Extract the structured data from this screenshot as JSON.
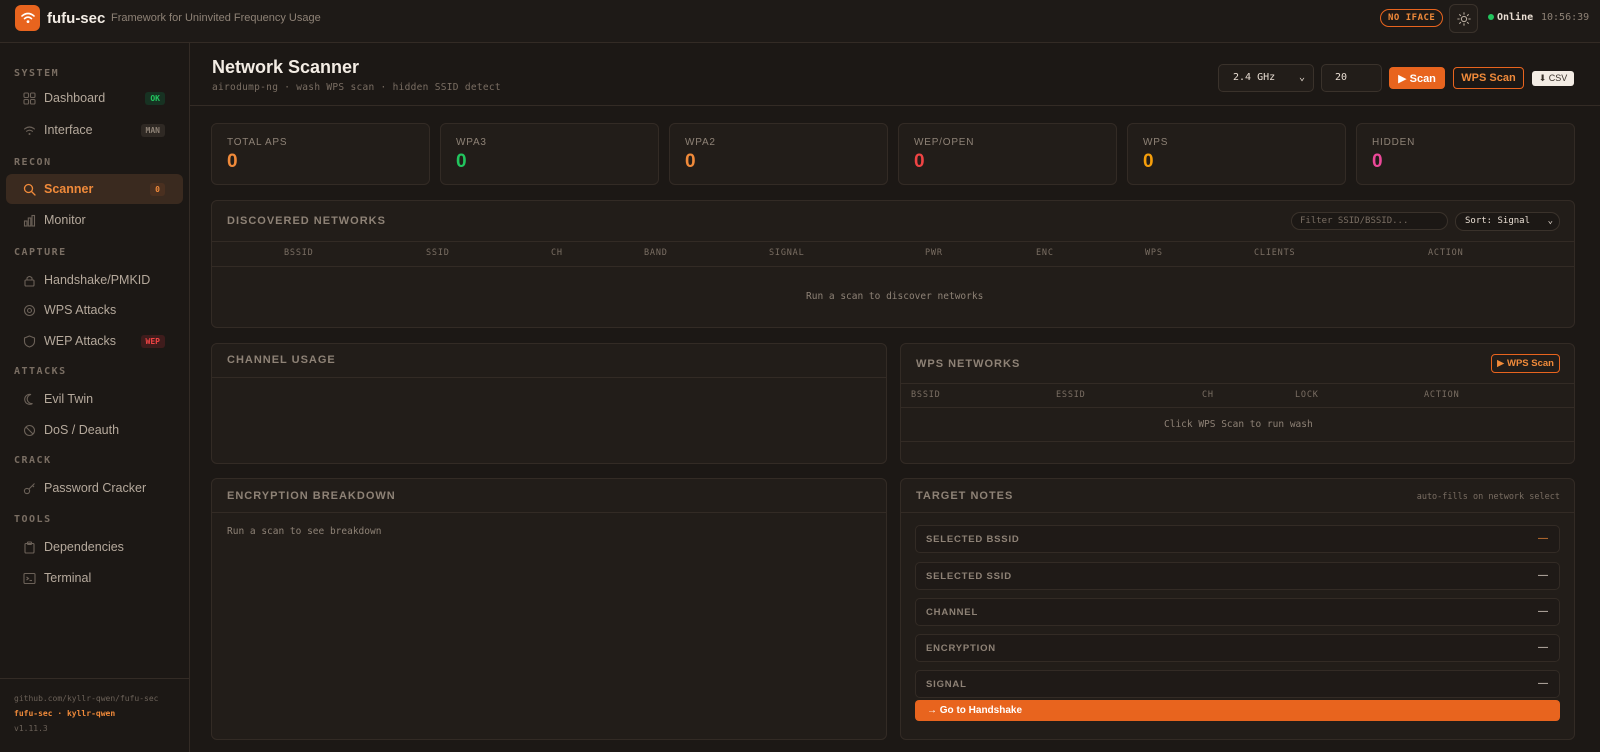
{
  "app": {
    "name": "fufu-sec",
    "tagline": "Framework for Uninvited Frequency Usage"
  },
  "topbar": {
    "iface_badge": "NO IFACE",
    "status": "Online",
    "clock": "10:56:39"
  },
  "sidebar": {
    "sections": {
      "system": "SYSTEM",
      "recon": "RECON",
      "capture": "CAPTURE",
      "attacks": "ATTACKS",
      "crack": "CRACK",
      "tools": "TOOLS"
    },
    "items": {
      "dashboard": {
        "label": "Dashboard",
        "badge": "OK"
      },
      "interface": {
        "label": "Interface",
        "badge": "MAN"
      },
      "scanner": {
        "label": "Scanner",
        "badge": "0"
      },
      "monitor": {
        "label": "Monitor"
      },
      "handshake": {
        "label": "Handshake/PMKID"
      },
      "wps": {
        "label": "WPS Attacks"
      },
      "wep": {
        "label": "WEP Attacks",
        "badge": "WEP"
      },
      "eviltwin": {
        "label": "Evil Twin"
      },
      "dos": {
        "label": "DoS / Deauth"
      },
      "cracker": {
        "label": "Password Cracker"
      },
      "deps": {
        "label": "Dependencies"
      },
      "terminal": {
        "label": "Terminal"
      }
    },
    "footer": {
      "repo": "github.com/kyllr-qwen/fufu-sec",
      "credit": "fufu-sec · kyllr-qwen",
      "version": "v1.11.3"
    }
  },
  "header": {
    "title": "Network Scanner",
    "subtitle": "airodump-ng · wash WPS scan · hidden SSID detect",
    "band": "2.4 GHz",
    "duration": "20",
    "scan_label": "▶ Scan",
    "wps_scan_label": "WPS Scan",
    "csv_label": "⬇ CSV"
  },
  "stats": [
    {
      "label": "TOTAL APS",
      "value": "0",
      "color": "#f08a3a"
    },
    {
      "label": "WPA3",
      "value": "0",
      "color": "#22c55e"
    },
    {
      "label": "WPA2",
      "value": "0",
      "color": "#f08a3a"
    },
    {
      "label": "WEP/OPEN",
      "value": "0",
      "color": "#ef4444"
    },
    {
      "label": "WPS",
      "value": "0",
      "color": "#f59e0b"
    },
    {
      "label": "HIDDEN",
      "value": "0",
      "color": "#ec4899"
    }
  ],
  "networks": {
    "title": "DISCOVERED NETWORKS",
    "filter_placeholder": "Filter SSID/BSSID...",
    "sort": "Sort: Signal",
    "columns": [
      "BSSID",
      "SSID",
      "CH",
      "BAND",
      "SIGNAL",
      "PWR",
      "ENC",
      "WPS",
      "CLIENTS",
      "ACTION"
    ],
    "empty": "Run a scan to discover networks"
  },
  "channel": {
    "title": "CHANNEL USAGE"
  },
  "wps_networks": {
    "title": "WPS NETWORKS",
    "button": "▶ WPS Scan",
    "columns": [
      "BSSID",
      "ESSID",
      "CH",
      "LOCK",
      "ACTION"
    ],
    "empty": "Click WPS Scan to run wash"
  },
  "encryption": {
    "title": "ENCRYPTION BREAKDOWN",
    "empty": "Run a scan to see breakdown"
  },
  "notes": {
    "title": "TARGET NOTES",
    "hint": "auto-fills on network select",
    "rows": [
      {
        "label": "SELECTED BSSID",
        "value": "—"
      },
      {
        "label": "SELECTED SSID",
        "value": "—"
      },
      {
        "label": "CHANNEL",
        "value": "—"
      },
      {
        "label": "ENCRYPTION",
        "value": "—"
      },
      {
        "label": "SIGNAL",
        "value": "—"
      }
    ],
    "go_button": "→ Go to Handshake"
  }
}
